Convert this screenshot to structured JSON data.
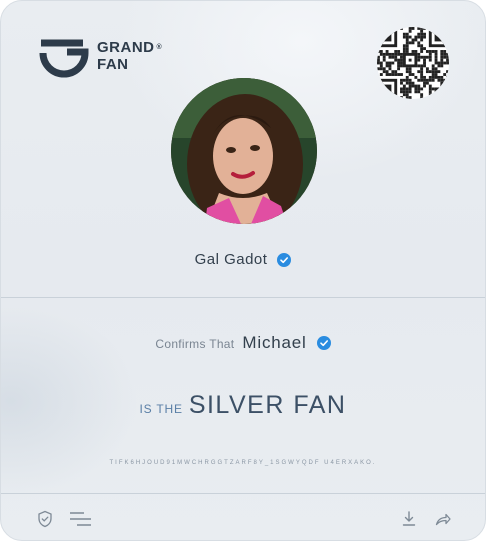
{
  "brand": {
    "line1": "GRAND",
    "line2": "FAN",
    "reg_mark": "®"
  },
  "celebrity": {
    "name": "Gal Gadot",
    "verified_icon": "verified-badge-icon"
  },
  "certificate": {
    "confirms_text": "Confirms That",
    "fan_name": "Michael",
    "is_the_text": "IS THE",
    "level": "SILVER FAN",
    "code": "TIFK6HJOUD91MWCHRGGTZARF8Y_1SGWYQDF U4ERXAKO."
  },
  "footer": {
    "left_icons": [
      "shield-check-icon",
      "menu-lines-icon"
    ],
    "right_icons": [
      "download-icon",
      "share-icon"
    ]
  },
  "colors": {
    "accent": "#2a8ce0",
    "text_dark": "#33404d",
    "level_text": "#3c5066",
    "background": "#e8ecf0"
  }
}
